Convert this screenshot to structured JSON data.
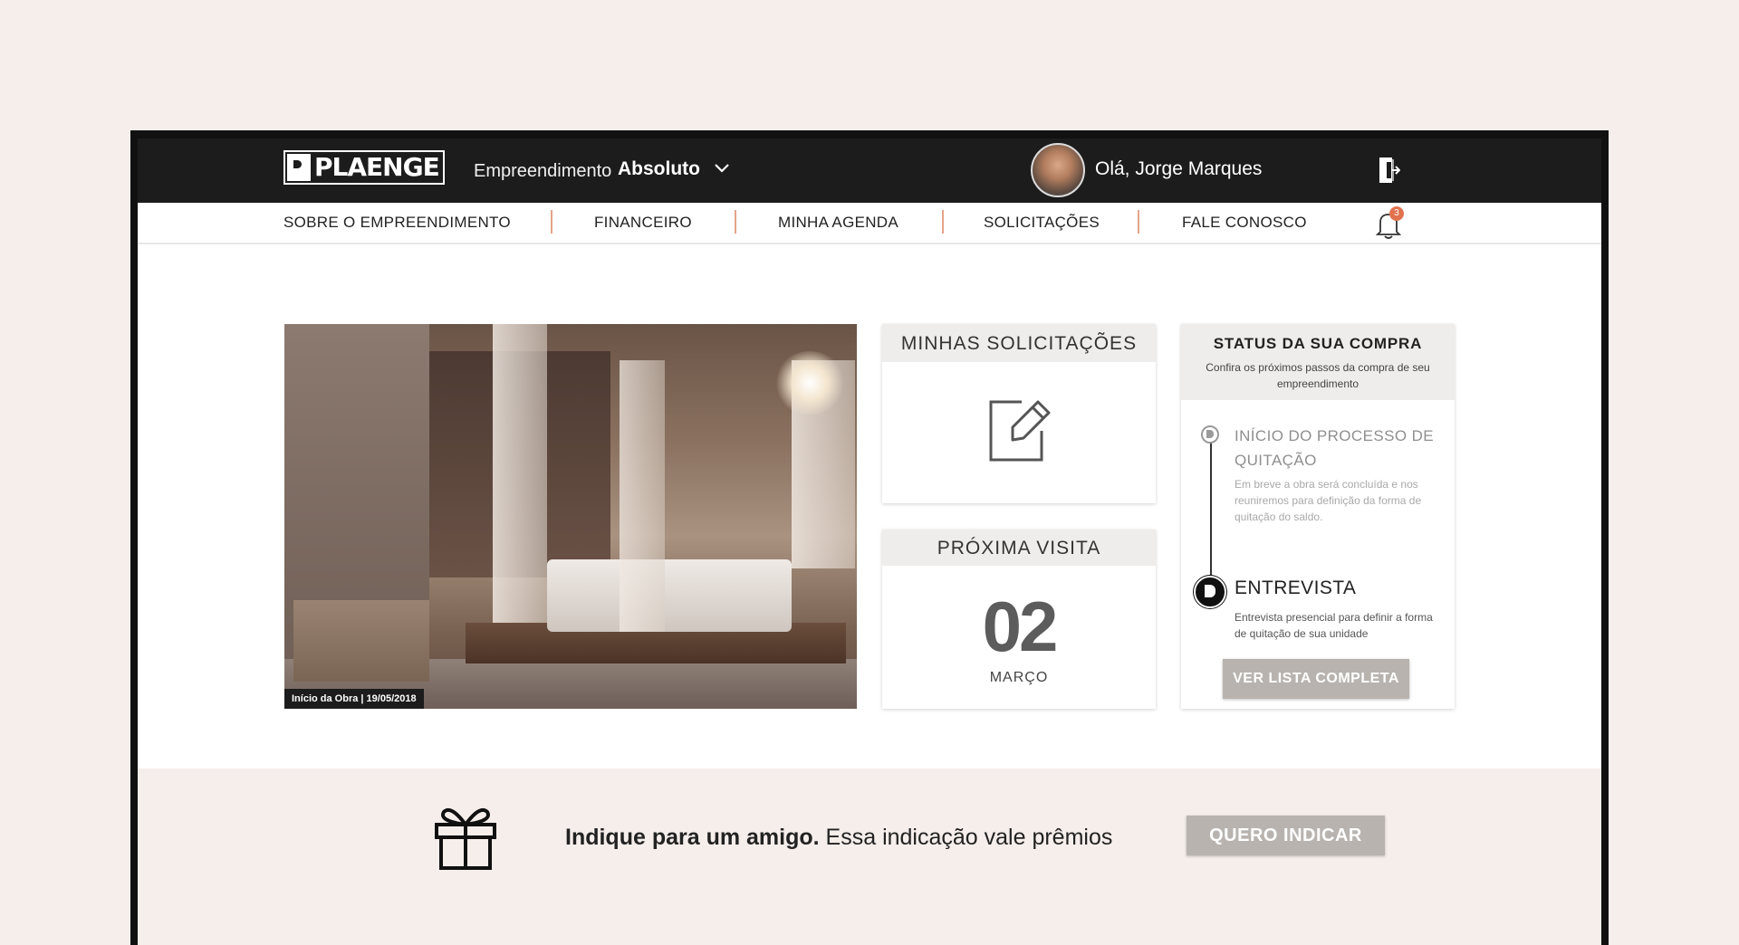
{
  "header": {
    "logo_text": "PLAENGE",
    "emp_label": "Empreendimento",
    "emp_value": "Absoluto",
    "greeting": "Olá, Jorge Marques"
  },
  "nav": {
    "items": [
      {
        "label": "SOBRE O EMPREENDIMENTO"
      },
      {
        "label": "FINANCEIRO"
      },
      {
        "label": "MINHA AGENDA"
      },
      {
        "label": "SOLICITAÇÕES"
      },
      {
        "label": "FALE CONOSCO"
      }
    ],
    "notification_count": "3"
  },
  "photo": {
    "caption": "Início da Obra | 19/05/2018"
  },
  "solicitacoes": {
    "title": "MINHAS SOLICITAÇÕES"
  },
  "visita": {
    "title": "PRÓXIMA VISITA",
    "day": "02",
    "month": "MARÇO"
  },
  "status": {
    "title": "STATUS DA SUA COMPRA",
    "subtitle": "Confira os próximos passos da compra de seu empreendimento",
    "steps": [
      {
        "title": "INÍCIO DO PROCESSO DE QUITAÇÃO",
        "text": "Em breve a obra será concluída e nos reuniremos para definição da forma de quitação do saldo."
      },
      {
        "title": "ENTREVISTA",
        "text": "Entrevista presencial para definir a forma de quitação de sua unidade"
      }
    ],
    "button_label": "VER LISTA COMPLETA"
  },
  "referral": {
    "bold_text": "Indique para um amigo.",
    "text": "Essa indicação vale prêmios",
    "button_label": "QUERO INDICAR"
  },
  "icons": {
    "dropdown": "chevron-down-icon",
    "logout": "logout-icon",
    "notifications": "bell-icon",
    "edit": "edit-icon",
    "gift": "gift-icon"
  },
  "colors": {
    "header_bg": "#1c1c1c",
    "accent": "#e2724f",
    "button_bg": "#b8b3af",
    "band_bg": "#f6eeeb"
  }
}
